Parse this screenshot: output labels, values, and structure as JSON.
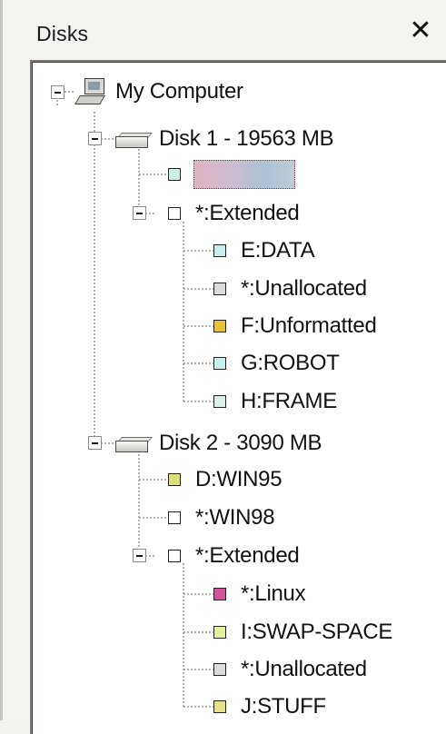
{
  "panel": {
    "title": "Disks",
    "close_glyph": "✕"
  },
  "tree": {
    "root_label": "My Computer",
    "disk1": {
      "label": "Disk 1 - 19563 MB",
      "selected_label": "",
      "extended_label": "*:Extended",
      "partitions": [
        {
          "label": "E:DATA",
          "color": "#c9eeee"
        },
        {
          "label": "*:Unallocated",
          "color": "#dcdcdc"
        },
        {
          "label": "F:Unformatted",
          "color": "#e8c23a"
        },
        {
          "label": "G:ROBOT",
          "color": "#c9eeee"
        },
        {
          "label": "H:FRAME",
          "color": "#ddf0ee"
        }
      ]
    },
    "disk2": {
      "label": "Disk 2 - 3090 MB",
      "partitions_top": [
        {
          "label": "D:WIN95",
          "color": "#dde07a"
        },
        {
          "label": "*:WIN98",
          "color": "#ffffff"
        }
      ],
      "extended_label": "*:Extended",
      "partitions": [
        {
          "label": "*:Linux",
          "color": "#d2559a"
        },
        {
          "label": "I:SWAP-SPACE",
          "color": "#dff0a0"
        },
        {
          "label": "*:Unallocated",
          "color": "#dcdcdc"
        },
        {
          "label": "J:STUFF",
          "color": "#e6e48a"
        }
      ]
    }
  },
  "colors": {
    "selected_partition": "#cfeee8",
    "extended_box": "#ffffff"
  }
}
